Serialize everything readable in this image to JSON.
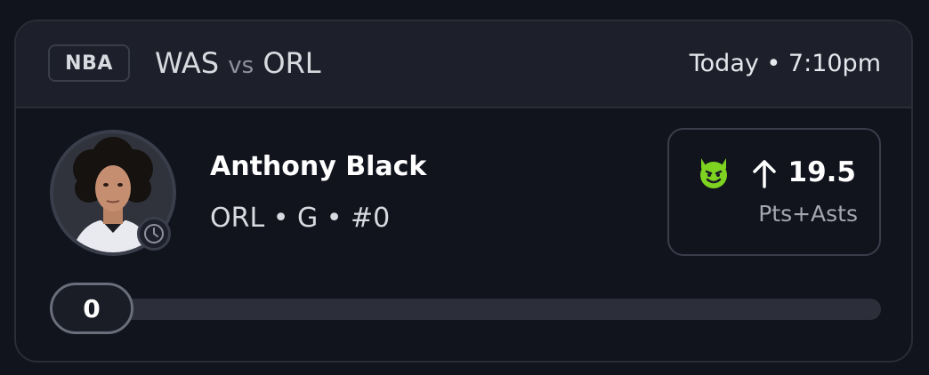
{
  "header": {
    "league": "NBA",
    "away_team": "WAS",
    "vs_label": "vs",
    "home_team": "ORL",
    "game_time": "Today • 7:10pm"
  },
  "player": {
    "name": "Anthony Black",
    "meta": "ORL • G • #0",
    "avatar_icon": "player-headshot",
    "status_icon": "clock-icon"
  },
  "pick": {
    "icon": "devil-face-icon",
    "direction_icon": "arrow-up-icon",
    "line": "19.5",
    "stat_type": "Pts+Asts",
    "accent_color": "#7ed321"
  },
  "progress": {
    "current": "0",
    "fraction": 0.0
  }
}
